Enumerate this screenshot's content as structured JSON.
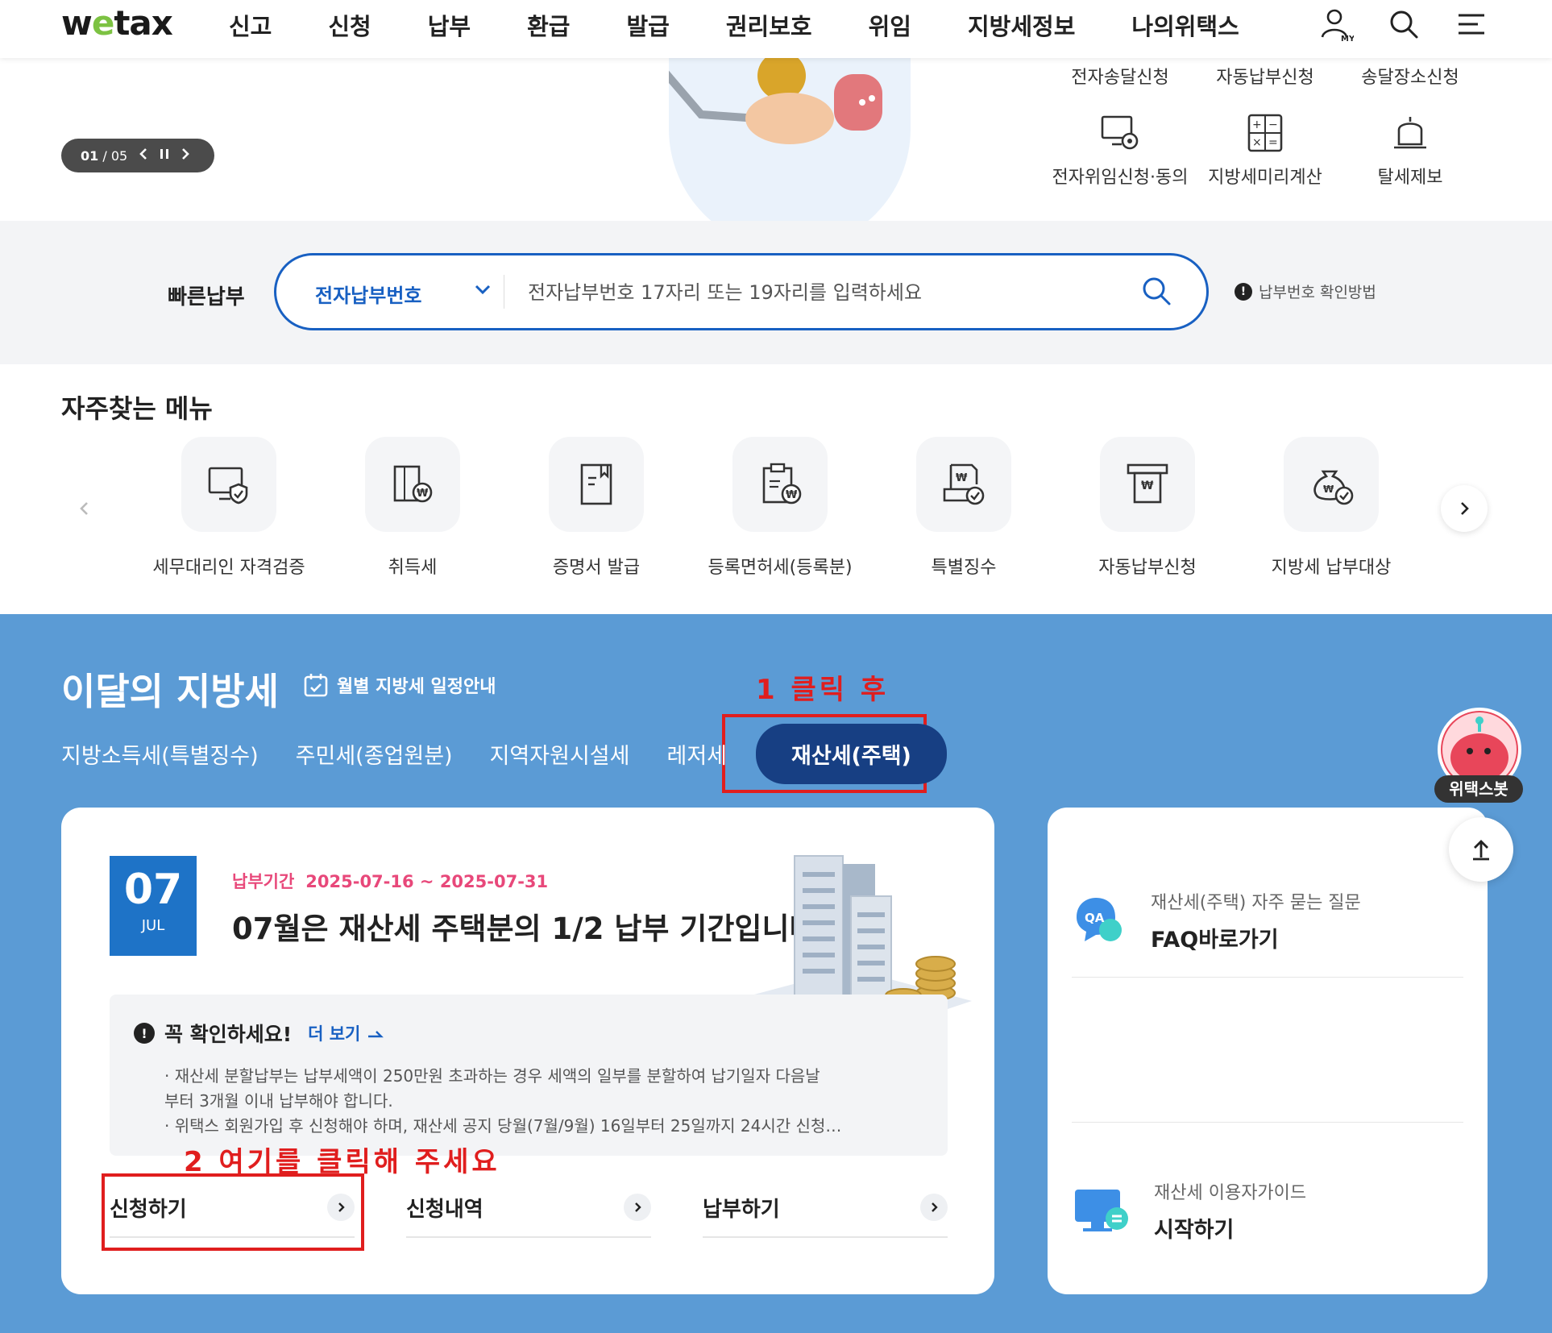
{
  "header": {
    "logo": "wetax",
    "nav": [
      "신고",
      "신청",
      "납부",
      "환급",
      "발급",
      "권리보호",
      "위임",
      "지방세정보",
      "나의위택스"
    ]
  },
  "banner": {
    "pager_current": "01",
    "pager_total": "/ 05",
    "quick_links_top": [
      "전자송달신청",
      "자동납부신청",
      "송달장소신청"
    ],
    "quick_links": [
      {
        "label": "전자위임신청·동의",
        "icon": "monitor-seal-icon"
      },
      {
        "label": "지방세미리계산",
        "icon": "calculator-icon"
      },
      {
        "label": "탈세제보",
        "icon": "bell-icon"
      }
    ]
  },
  "quickpay": {
    "label": "빠른납부",
    "select_value": "전자납부번호",
    "placeholder": "전자납부번호 17자리 또는 19자리를 입력하세요",
    "help": "납부번호 확인방법"
  },
  "frequent": {
    "title": "자주찾는 메뉴",
    "items": [
      {
        "label": "세무대리인 자격검증",
        "icon": "monitor-shield-icon"
      },
      {
        "label": "취득세",
        "icon": "building-won-icon"
      },
      {
        "label": "증명서 발급",
        "icon": "document-icon"
      },
      {
        "label": "등록면허세(등록분)",
        "icon": "clipboard-won-icon"
      },
      {
        "label": "특별징수",
        "icon": "tray-won-icon"
      },
      {
        "label": "자동납부신청",
        "icon": "atm-won-icon"
      },
      {
        "label": "지방세 납부대상",
        "icon": "money-bag-icon"
      }
    ]
  },
  "monthly": {
    "title": "이달의 지방세",
    "schedule_link": "월별 지방세 일정안내",
    "tabs": [
      "지방소득세(특별징수)",
      "주민세(종업원분)",
      "지역자원시설세",
      "레저세",
      "재산세(주택)"
    ],
    "active_tab": "재산세(주택)",
    "annotation_1": "1 클릭 후",
    "annotation_2": "2 여기를 클릭해 주세요",
    "date_day": "07",
    "date_month": "JUL",
    "period_label": "납부기간",
    "period_value": "2025-07-16 ~ 2025-07-31",
    "headline": "07월은 재산세 주택분의 1/2 납부 기간입니다.",
    "notice_title": "꼭 확인하세요!",
    "notice_more": "더 보기",
    "notice_line1": "· 재산세 분할납부는 납부세액이 250만원 초과하는 경우 세액의 일부를 분할하여 납기일자 다음날",
    "notice_line2": "부터 3개월 이내 납부해야 합니다.",
    "notice_line3": "· 위택스 회원가입 후 신청해야 하며, 재산세 공지 당월(7월/9월) 16일부터 25일까지 24시간 신청…",
    "actions": [
      "신청하기",
      "신청내역",
      "납부하기"
    ]
  },
  "side": {
    "faq_sub": "재산세(주택) 자주 묻는 질문",
    "faq_main": "FAQ바로가기",
    "guide_sub": "재산세 이용자가이드",
    "guide_main": "시작하기"
  },
  "chatbot_label": "위택스봇",
  "colors": {
    "primary": "#1860c2",
    "section_bg": "#5b9bd5",
    "active_tab": "#173f83",
    "annotation": "#e01e1e",
    "period": "#e8487a"
  }
}
